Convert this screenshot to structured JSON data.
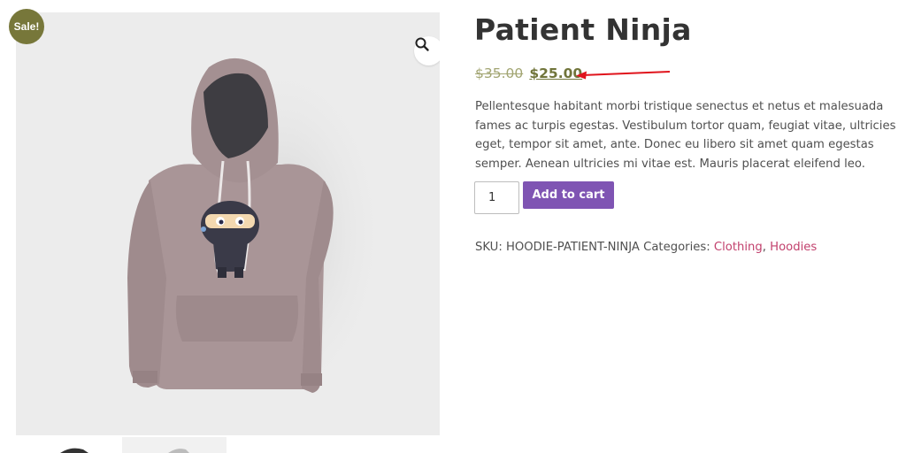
{
  "product": {
    "title": "Patient Ninja",
    "sale_badge": "Sale!",
    "price_old": "$35.00",
    "price_new": "$25.00",
    "description": "Pellentesque habitant morbi tristique senectus et netus et malesuada fames ac turpis egestas. Vestibulum tortor quam, feugiat vitae, ultricies eget, tempor sit amet, ante. Donec eu libero sit amet quam egestas semper. Aenean ultricies mi vitae est. Mauris placerat eleifend leo.",
    "quantity": "1",
    "add_to_cart_label": "Add to cart",
    "sku_label": "SKU:",
    "sku": "HOODIE-PATIENT-NINJA",
    "categories_label": "Categories:",
    "categories": [
      "Clothing",
      "Hoodies"
    ],
    "category_separator": ","
  },
  "icons": {
    "zoom": "magnifier-icon"
  },
  "colors": {
    "sale_badge": "#77773a",
    "price_new": "#70743a",
    "price_old": "#a2a572",
    "button": "#7f54b3",
    "link": "#c2416d",
    "annotation_arrow": "#e0141c",
    "hoodie": "#a89496"
  }
}
